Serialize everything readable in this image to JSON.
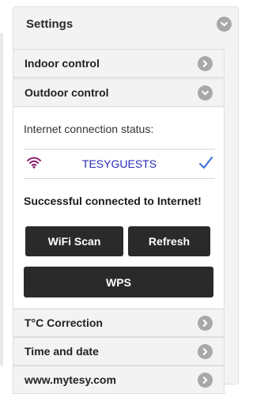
{
  "settings": {
    "title": "Settings",
    "icon": "chevron-down-icon"
  },
  "sections": [
    {
      "label": "Indoor control",
      "icon": "chevron-right-icon"
    },
    {
      "label": "Outdoor control",
      "icon": "chevron-down-icon"
    },
    {
      "label": "T°C Correction",
      "icon": "chevron-right-icon"
    },
    {
      "label": "Time and date",
      "icon": "chevron-right-icon"
    },
    {
      "label": "www.mytesy.com",
      "icon": "chevron-right-icon"
    }
  ],
  "outdoor": {
    "status_label": "Internet connection status:",
    "network": {
      "ssid": "TESYGUESTS",
      "connected": true
    },
    "success_message": "Successful connected to Internet!",
    "buttons": {
      "wifi_scan": "WiFi Scan",
      "refresh": "Refresh",
      "wps": "WPS"
    }
  },
  "colors": {
    "accent_dark": "#2a2a2a",
    "ssid_text": "#2b2bb5",
    "wifi_icon": "#8b1a6e",
    "check": "#3a6fd0",
    "chevron": "#a8a8a8"
  }
}
